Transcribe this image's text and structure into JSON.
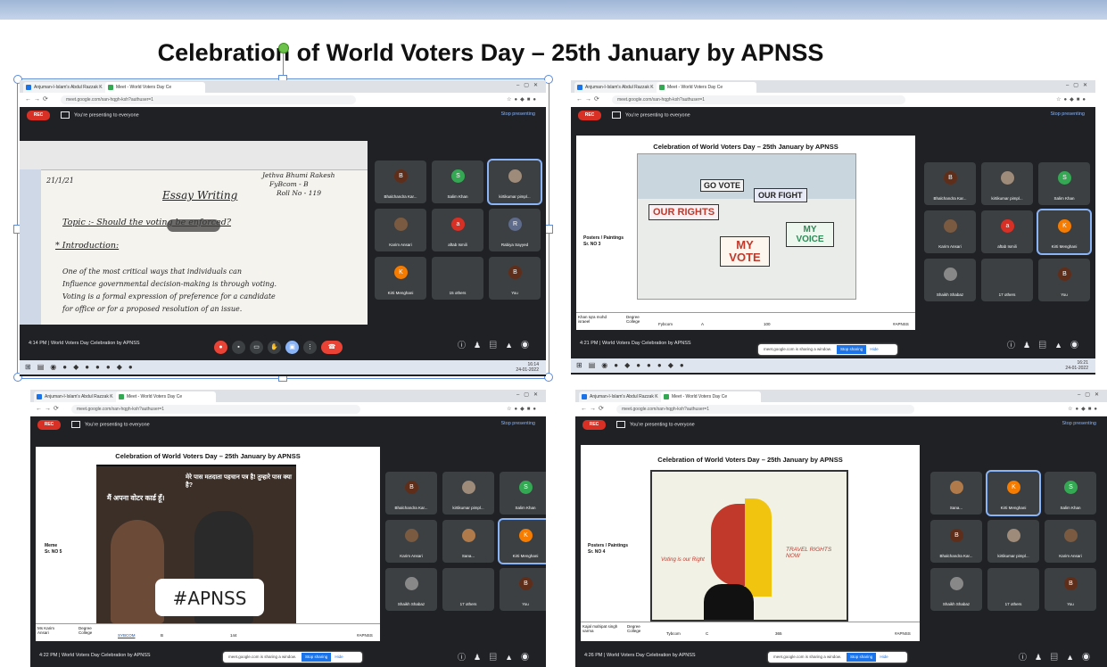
{
  "slide": {
    "title": "Celebration of World Voters Day – 25th January by APNSS"
  },
  "browser": {
    "tab1": "Anjuman-I-Islam's Abdul Razzak K",
    "tab2": "Meet - World Voters Day Ce",
    "url": "meet.google.com/xan-hqgh-kxh?authuser=1"
  },
  "meet": {
    "rec": "REC",
    "presenting": "You're presenting to everyone",
    "stop_presenting": "Stop presenting",
    "meeting_name": "World Voters Day Celebration by APNSS",
    "sharing_notice": "meet.google.com is sharing a window.",
    "stop_sharing": "Stop sharing",
    "hide": "Hide"
  },
  "colors": {
    "meet_bg": "#202124",
    "tile_bg": "#3c4043",
    "rec_red": "#d93025",
    "accent_blue": "#8ab4f8",
    "share_blue": "#1a73e8"
  },
  "shots": [
    {
      "time": "4:14 PM",
      "clock": [
        "16:14",
        "24-01-2022"
      ],
      "share": {
        "date": "21/1/21",
        "heading": "Essay Writing",
        "author": [
          "Jethva Bhumi Rakesh",
          "FyBcom - B",
          "Roll No - 119"
        ],
        "topic": "Topic :- Should the voting be enforced?",
        "intro": "Introduction:",
        "lines": [
          "One of the most critical ways that individuals can",
          "Influence governmental decision-making is through voting.",
          "Voting is a formal expression of preference for a candidate",
          "for office or for a proposed resolution of an issue."
        ]
      },
      "tiles": [
        {
          "name": "Bhalchandra Kar...",
          "initial": "B",
          "color": "#5f2e1a"
        },
        {
          "name": "Salim Khan",
          "initial": "S",
          "color": "#34a853"
        },
        {
          "name": "kirtikumar pimpl...",
          "initial": "",
          "color": "#9e8b7a"
        },
        {
          "name": "Karim Ansari",
          "initial": "",
          "color": "#7a5a40"
        },
        {
          "name": "aftab Ismili",
          "initial": "a",
          "color": "#d93025"
        },
        {
          "name": "Rabiya Sayyed",
          "initial": "R",
          "color": "#5f6b8a"
        },
        {
          "name": "Kirti Menghani",
          "initial": "K",
          "color": "#f57c00"
        },
        {
          "name": "15 others",
          "initial": "",
          "color": "#3c4043"
        },
        {
          "name": "You",
          "initial": "B",
          "color": "#5f2e1a"
        }
      ]
    },
    {
      "time": "4:21 PM",
      "clock": [
        "16:21",
        "24-01-2022"
      ],
      "share": {
        "title": "Celebration of World Voters Day – 25th January by APNSS",
        "side_label": [
          "Posters / Paintings",
          "Sr. NO 3"
        ],
        "poster_words": [
          "GO VOTE",
          "OUR RIGHTS",
          "OUR FIGHT",
          "MY VOTE",
          "MY VOICE"
        ],
        "row": [
          "Khan Iqra mohd israeel",
          "Degree College",
          "Fybcom",
          "A",
          "100",
          "#APNSS"
        ]
      },
      "tiles": [
        {
          "name": "Bhalchandra Kar...",
          "initial": "B",
          "color": "#5f2e1a"
        },
        {
          "name": "kirtikumar pimpl...",
          "initial": "",
          "color": "#9e8b7a"
        },
        {
          "name": "Salim Khan",
          "initial": "S",
          "color": "#34a853"
        },
        {
          "name": "Karim Ansari",
          "initial": "",
          "color": "#7a5a40"
        },
        {
          "name": "aftab Ismili",
          "initial": "a",
          "color": "#d93025"
        },
        {
          "name": "Kirti Menghani",
          "initial": "K",
          "color": "#f57c00"
        },
        {
          "name": "Shaikh Shabaz",
          "initial": "",
          "color": "#888"
        },
        {
          "name": "17 others",
          "initial": "",
          "color": "#3c4043"
        },
        {
          "name": "You",
          "initial": "B",
          "color": "#5f2e1a"
        }
      ]
    },
    {
      "time": "4:22 PM",
      "clock": [
        "",
        ""
      ],
      "share": {
        "title": "Celebration of World Voters Day – 25th January by APNSS",
        "side_label": [
          "Meme",
          "Sr. NO 5"
        ],
        "hindi1": "मैं अपना वोटर कार्ड हूँ।",
        "hindi2": "मेरे पास मतदाता पहचान पत्र है! तुम्हारे पास क्या है?",
        "hashtag": "#APNSS",
        "row": [
          "Ms Karim Ansari",
          "Degree College",
          "SYBCOM",
          "B",
          "144",
          "#APNSS"
        ]
      },
      "tiles": [
        {
          "name": "Bhalchandra Kar...",
          "initial": "B",
          "color": "#5f2e1a"
        },
        {
          "name": "kirtikumar pimpl...",
          "initial": "",
          "color": "#9e8b7a"
        },
        {
          "name": "Salim Khan",
          "initial": "S",
          "color": "#34a853"
        },
        {
          "name": "Karim Ansari",
          "initial": "",
          "color": "#7a5a40"
        },
        {
          "name": "Sana...",
          "initial": "",
          "color": "#b07a4a"
        },
        {
          "name": "Kirti Menghani",
          "initial": "K",
          "color": "#f57c00"
        },
        {
          "name": "Shaikh Shabaz",
          "initial": "",
          "color": "#888"
        },
        {
          "name": "17 others",
          "initial": "",
          "color": "#3c4043"
        },
        {
          "name": "You",
          "initial": "B",
          "color": "#5f2e1a"
        }
      ]
    },
    {
      "time": "4:26 PM",
      "clock": [
        "",
        ""
      ],
      "share": {
        "title": "Celebration of World Voters Day – 25th January by APNSS",
        "side_label": [
          "Posters / Paintings",
          "Sr. NO 4"
        ],
        "art_words": [
          "Voting is our Right",
          "TRAVEL RIGHTS NOW"
        ],
        "row": [
          "Kajal mahipat singh varma",
          "Degree College",
          "Tybcom",
          "C",
          "365",
          "#APNSS"
        ]
      },
      "tiles": [
        {
          "name": "Sana...",
          "initial": "",
          "color": "#b07a4a"
        },
        {
          "name": "Kirti Menghani",
          "initial": "K",
          "color": "#f57c00"
        },
        {
          "name": "Salim Khan",
          "initial": "S",
          "color": "#34a853"
        },
        {
          "name": "Bhalchandra Kar...",
          "initial": "B",
          "color": "#5f2e1a"
        },
        {
          "name": "kirtikumar pimpl...",
          "initial": "",
          "color": "#9e8b7a"
        },
        {
          "name": "Karim Ansari",
          "initial": "",
          "color": "#7a5a40"
        },
        {
          "name": "Shaikh Shabaz",
          "initial": "",
          "color": "#888"
        },
        {
          "name": "17 others",
          "initial": "",
          "color": "#3c4043"
        },
        {
          "name": "You",
          "initial": "B",
          "color": "#5f2e1a"
        }
      ]
    }
  ]
}
